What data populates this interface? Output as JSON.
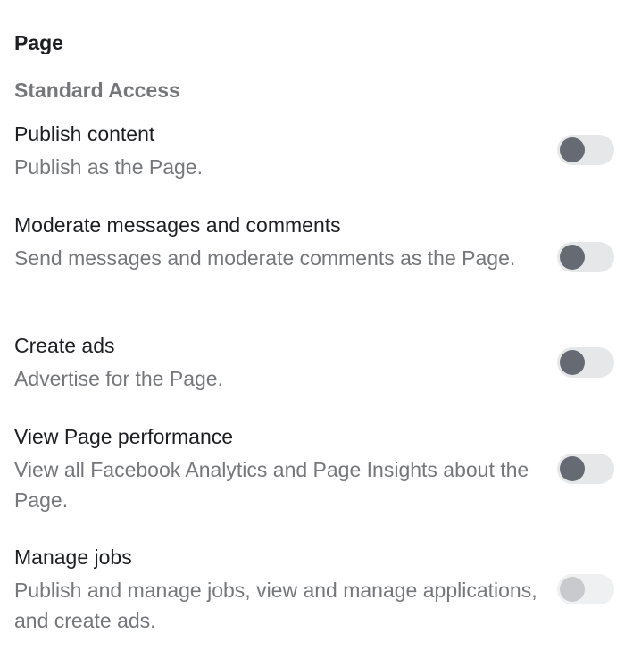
{
  "section": {
    "title": "Page",
    "subsection_title": "Standard Access"
  },
  "permissions": [
    {
      "title": "Publish content",
      "description": "Publish as the Page.",
      "enabled": false,
      "disabled": false
    },
    {
      "title": "Moderate messages and comments",
      "description": "Send messages and moderate comments as the Page.",
      "enabled": false,
      "disabled": false
    },
    {
      "title": "Create ads",
      "description": "Advertise for the Page.",
      "enabled": false,
      "disabled": false
    },
    {
      "title": "View Page performance",
      "description": "View all Facebook Analytics and Page Insights about the Page.",
      "enabled": false,
      "disabled": false
    },
    {
      "title": "Manage jobs",
      "description": "Publish and manage jobs, view and manage applications, and create ads.",
      "enabled": false,
      "disabled": true
    }
  ],
  "colors": {
    "title_text": "#1c1e21",
    "secondary_text": "#75777b",
    "toggle_track": "#e6e7e9",
    "toggle_knob": "#656a73",
    "toggle_disabled_track": "#eff0f1",
    "toggle_disabled_knob": "#c8cacd"
  }
}
